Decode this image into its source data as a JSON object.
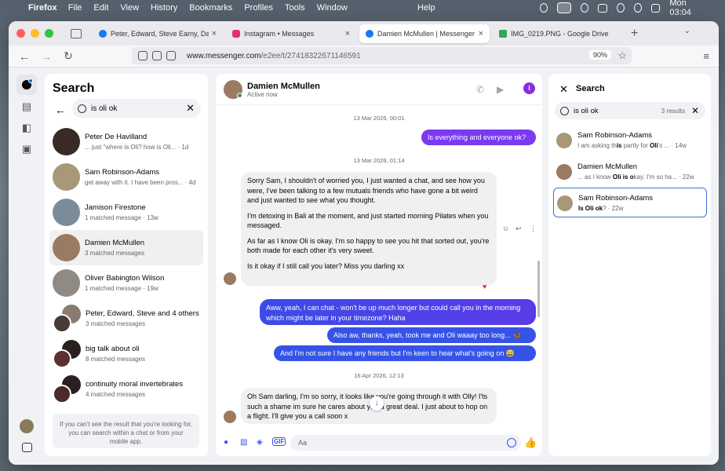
{
  "menubar": {
    "app": "Firefox",
    "items": [
      "File",
      "Edit",
      "View",
      "History",
      "Bookmarks",
      "Profiles",
      "Tools",
      "Window"
    ],
    "help": "Help",
    "clock": "Mon 03:04"
  },
  "tabs": [
    {
      "title": "Peter, Edward, Steve Earny, Dan",
      "color": "#1877f2"
    },
    {
      "title": "Instagram • Messages",
      "color": "#e1306c"
    },
    {
      "title": "Damien McMullen | Messenger",
      "color": "#1877f2"
    },
    {
      "title": "IMG_0219.PNG - Google Drive",
      "color": "#34a853"
    }
  ],
  "url": {
    "host": "www.messenger.com",
    "path": "/e2ee/t/27418322671146591",
    "zoom": "90%"
  },
  "search": {
    "title": "Search",
    "query": "is oli ok",
    "results": [
      {
        "name": "Peter De Havilland",
        "snippet": "... just \"where is Oli? how is Oli...",
        "time": "1d",
        "color": "#3a2a25"
      },
      {
        "name": "Sam Robinson-Adams",
        "snippet": "get away with it. I have been pros...",
        "time": "4d",
        "color": "#a89878"
      },
      {
        "name": "Jamison Firestone",
        "snippet": "1 matched message",
        "time": "13w",
        "color": "#7a8c9a"
      },
      {
        "name": "Damien McMullen",
        "snippet": "3 matched messages",
        "time": "",
        "color": "#9a7a60"
      },
      {
        "name": "Oliver Babington Wilson",
        "snippet": "1 matched message",
        "time": "19w",
        "color": "#8f8a84"
      },
      {
        "name": "Peter, Edward, Steve and 4 others",
        "snippet": "3 matched messages",
        "time": "",
        "color": "#4a3a36"
      },
      {
        "name": "big talk about oli",
        "snippet": "8 matched messages",
        "time": "",
        "color": "#5a3030"
      },
      {
        "name": "continuity moral invertebrates",
        "snippet": "4 matched messages",
        "time": "",
        "color": "#4a2a2a"
      }
    ],
    "hint": "If you can't see the result that you're looking for, you can search within a chat or from your mobile app."
  },
  "chat": {
    "name": "Damien McMullen",
    "status": "Active now",
    "ts1": "13 Mar 2026, 00:01",
    "m1": "Is everything and everyone ok?",
    "ts2": "13 Mar 2026, 01:14",
    "m2a": "Sorry Sam, I shouldn't  of worried you, I just wanted a chat, and see how you were, I've been talking to a few mutuals friends who have gone a bit weird and just wanted to see what you thought.",
    "m2b": "I'm detoxing in Bali at the moment, and just started morning Pilates when you messaged.",
    "m2c": "As far as I know Oli is okay. I'm so happy to see you hit that sorted out, you're both made for each other it's very sweet.",
    "m2d": "Is it okay if I still call you later? Miss you darling xx",
    "m3": "Aww, yeah, I can chat - won't be up much longer but could call you in the morning which might be later in your timezone? Haha",
    "m4": "Also aw, thanks, yeah, took me and Oli waaay too long... 🦋",
    "m5": "And I'm not sure I have any friends but I'm keen to hear what's going on 😅",
    "ts3": "16 Apr 2026, 12:13",
    "m6": "Oh Sam darling, I'm so sorry, it looks like you're going through it with Olly! I'ts such a shame im sure he cares about you a great deal. I just about to hop on a flight. I'll give you a call soon x",
    "placeholder": "Aa"
  },
  "rsearch": {
    "title": "Search",
    "query": "is oli ok",
    "count": "3 results",
    "results": [
      {
        "name": "Sam Robinson-Adams",
        "pre": "I am asking th",
        "hit": "is",
        "post": " partly for ",
        "hit2": "Oli",
        "post2": "'s ...",
        "time": "· 14w"
      },
      {
        "name": "Damien McMullen",
        "pre": "... as I know ",
        "hit": "Oli is o",
        "post": "kay. I'm so ha...",
        "hit2": "",
        "post2": "",
        "time": "· 22w"
      },
      {
        "name": "Sam Robinson-Adams",
        "pre": "",
        "hit": "Is Oli ok",
        "post": "? ",
        "hit2": "",
        "post2": "",
        "time": "· 22w"
      }
    ]
  }
}
